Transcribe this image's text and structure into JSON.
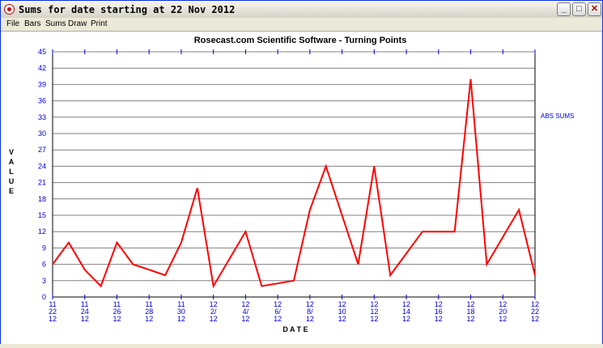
{
  "window": {
    "title": "Sums for date starting at 22 Nov 2012",
    "buttons": {
      "minimize": "_",
      "maximize": "□",
      "close": "✕"
    }
  },
  "menu": [
    "File",
    "Bars",
    "Sums",
    "Draw",
    "Print"
  ],
  "chart_data": {
    "type": "line",
    "title": "Rosecast.com Scientific Software - Turning Points",
    "xlabel": "D A T E",
    "ylabel": "V A L U E",
    "ylabel_letters": [
      "V",
      "A",
      "L",
      "U",
      "E"
    ],
    "legend": "ABS SUMS",
    "legend_position": "right",
    "ylim": [
      0,
      45
    ],
    "yticks": [
      "0",
      "3",
      "6",
      "9",
      "12",
      "15",
      "18",
      "21",
      "24",
      "27",
      "30",
      "33",
      "36",
      "39",
      "42",
      "45"
    ],
    "xtick_labels": [
      [
        "11",
        "22",
        "12"
      ],
      [
        "11",
        "24",
        "12"
      ],
      [
        "11",
        "26",
        "12"
      ],
      [
        "11",
        "28",
        "12"
      ],
      [
        "11",
        "30",
        "12"
      ],
      [
        "12",
        "2/",
        "12"
      ],
      [
        "12",
        "4/",
        "12"
      ],
      [
        "12",
        "6/",
        "12"
      ],
      [
        "12",
        "8/",
        "12"
      ],
      [
        "12",
        "10",
        "12"
      ],
      [
        "12",
        "12",
        "12"
      ],
      [
        "12",
        "14",
        "12"
      ],
      [
        "12",
        "16",
        "12"
      ],
      [
        "12",
        "18",
        "12"
      ],
      [
        "12",
        "20",
        "12"
      ],
      [
        "12",
        "22",
        "12"
      ]
    ],
    "grid": true,
    "colors": {
      "line": "#ff0000",
      "axis_text": "#0000cc",
      "grid": "#808080"
    },
    "series": [
      {
        "values": [
          6,
          10,
          5,
          2,
          10,
          6,
          5,
          4,
          10,
          20,
          2,
          7,
          12,
          2,
          2.5,
          3,
          16,
          24,
          15,
          6,
          24,
          4,
          8,
          12,
          12,
          12,
          40,
          6,
          11,
          16,
          4
        ]
      }
    ]
  }
}
